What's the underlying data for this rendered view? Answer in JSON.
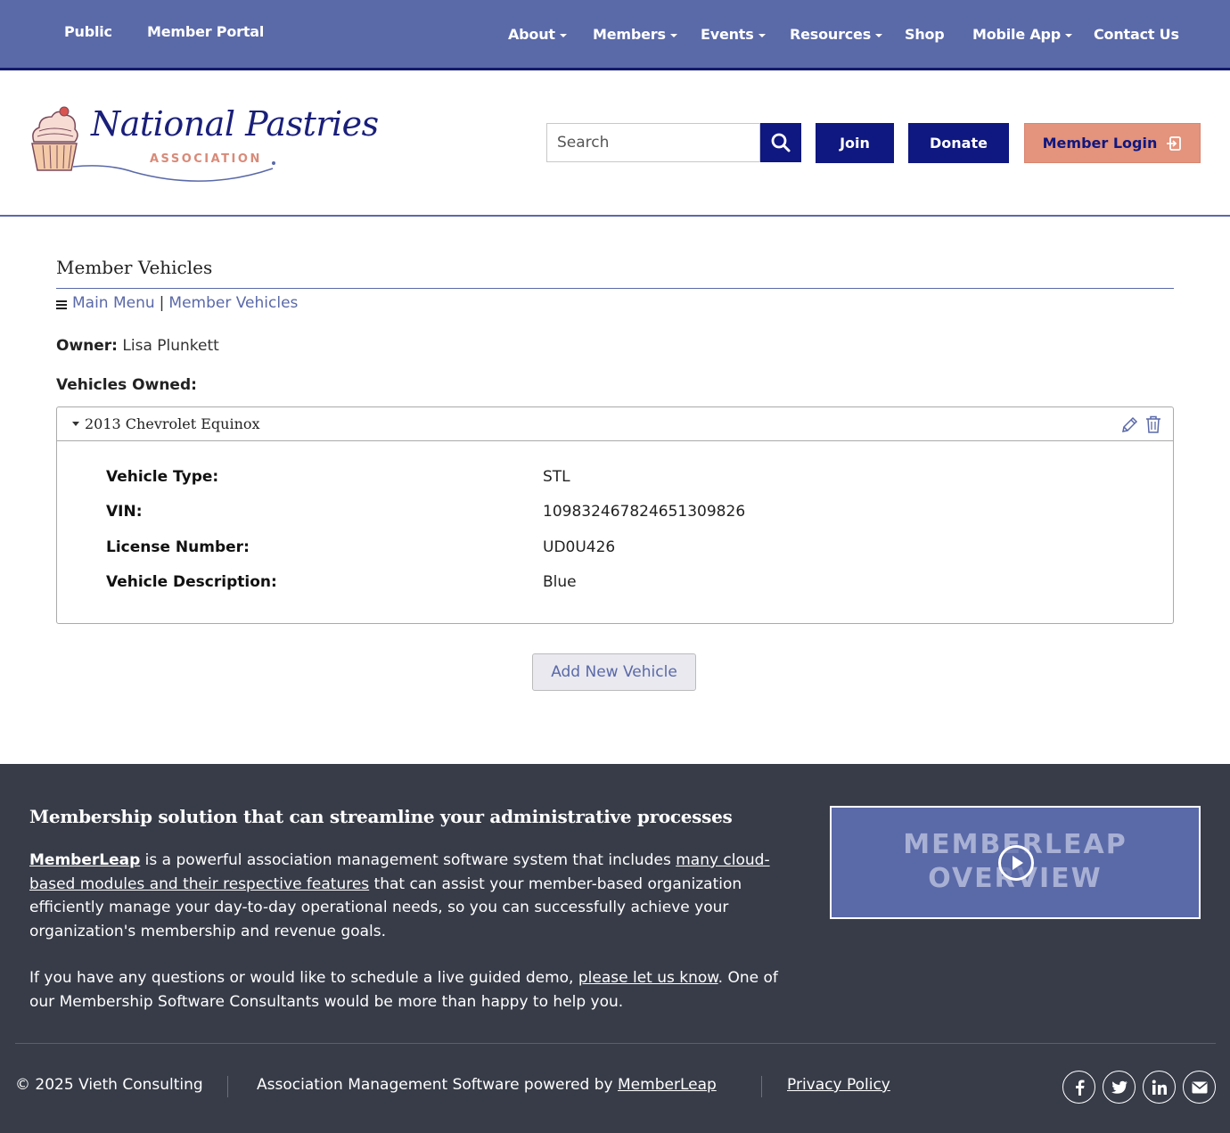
{
  "topnav": {
    "left": [
      "Public",
      "Member Portal"
    ],
    "right": [
      {
        "label": "About",
        "dropdown": true
      },
      {
        "label": "Members",
        "dropdown": true
      },
      {
        "label": "Events",
        "dropdown": true
      },
      {
        "label": "Resources",
        "dropdown": true
      },
      {
        "label": "Shop",
        "dropdown": false
      },
      {
        "label": "Mobile App",
        "dropdown": true
      },
      {
        "label": "Contact Us",
        "dropdown": false
      }
    ]
  },
  "header": {
    "logo_name": "National Pastries",
    "logo_sub": "ASSOCIATION",
    "search_placeholder": "Search",
    "join_label": "Join",
    "donate_label": "Donate",
    "login_label": "Member Login"
  },
  "main": {
    "title": "Member Vehicles",
    "breadcrumb": {
      "main_menu": "Main Menu",
      "separator": "|",
      "current": "Member Vehicles"
    },
    "owner_label": "Owner:",
    "owner_name": "Lisa Plunkett",
    "vehicles_owned_label": "Vehicles Owned:",
    "vehicle": {
      "name": "2013 Chevrolet Equinox",
      "fields": [
        {
          "label": "Vehicle Type:",
          "value": "STL"
        },
        {
          "label": "VIN:",
          "value": "109832467824651309826"
        },
        {
          "label": "License Number:",
          "value": "UD0U426"
        },
        {
          "label": "Vehicle Description:",
          "value": "Blue"
        }
      ]
    },
    "add_button": "Add New Vehicle"
  },
  "footer": {
    "title": "Membership solution that can streamline your administrative processes",
    "para1": {
      "link1": "MemberLeap",
      "text1": " is a powerful association management software system that includes ",
      "link2": "many cloud-based modules and their respective features",
      "text2": " that can assist your member-based organization efficiently manage your day-to-day operational needs, so you can successfully achieve your organization's membership and revenue goals."
    },
    "para2": {
      "text1": "If you have any questions or would like to schedule a live guided demo, ",
      "link": "please let us know",
      "text2": ". One of our Membership Software Consultants would be more than happy to help you."
    },
    "video_line1": "MEMBERLEAP",
    "video_line2": "OVERVIEW",
    "copyright": "© 2025 Vieth Consulting",
    "powered_text": "Association Management Software powered by ",
    "powered_link": "MemberLeap",
    "privacy": "Privacy Policy",
    "social": [
      "facebook-icon",
      "twitter-icon",
      "linkedin-icon",
      "email-icon"
    ]
  },
  "colors": {
    "nav_bg": "#5a69a8",
    "dark_blue": "#0f1780",
    "login_bg": "#e4937c",
    "footer_bg": "#373c48"
  }
}
